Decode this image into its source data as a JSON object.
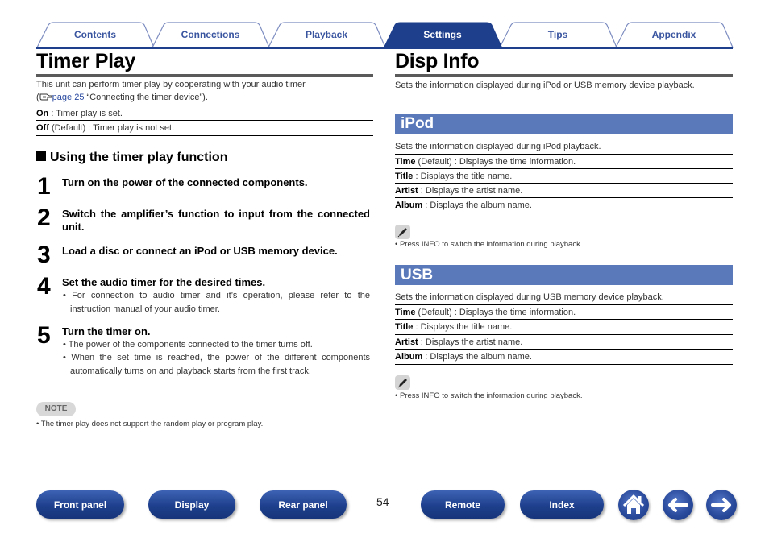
{
  "tabs": [
    {
      "label": "Contents",
      "active": false
    },
    {
      "label": "Connections",
      "active": false
    },
    {
      "label": "Playback",
      "active": false
    },
    {
      "label": "Settings",
      "active": true
    },
    {
      "label": "Tips",
      "active": false
    },
    {
      "label": "Appendix",
      "active": false
    }
  ],
  "colors": {
    "brand": "#1e3f8c",
    "band": "#5a79bb",
    "tab_text": "#3a55a0"
  },
  "left": {
    "title": "Timer Play",
    "intro_line1": "This unit can perform timer play by cooperating with your audio timer",
    "intro_open": "(",
    "intro_link": "page 25",
    "intro_rest": " “Connecting the timer device”).",
    "options": [
      {
        "key": "On",
        "desc": " : Timer play is set."
      },
      {
        "key": "Off",
        "desc": " (Default) : Timer play is not set."
      }
    ],
    "subheading": "Using the timer play function",
    "steps": [
      {
        "num": "1",
        "title": "Turn on the power of the connected components.",
        "bullets": []
      },
      {
        "num": "2",
        "title": "Switch the amplifier’s function to input from the connected unit.",
        "bullets": []
      },
      {
        "num": "3",
        "title": "Load a disc or connect an iPod or USB memory device.",
        "bullets": []
      },
      {
        "num": "4",
        "title": "Set the audio timer for the desired times.",
        "bullets": [
          "• For connection to audio timer and it’s operation, please refer to the instruction manual of your audio timer."
        ]
      },
      {
        "num": "5",
        "title": "Turn the timer on.",
        "bullets": [
          "• The power of the components connected to the timer turns off.",
          "• When the set time is reached, the power of the different components automatically turns on and playback starts from the first track."
        ]
      }
    ],
    "note_label": "NOTE",
    "note_text": "• The timer play does not support the random play or program play."
  },
  "right": {
    "title": "Disp Info",
    "intro": "Sets the information displayed during iPod or USB memory device playback.",
    "sections": [
      {
        "heading": "iPod",
        "desc": "Sets the information displayed during iPod playback.",
        "options": [
          {
            "key": "Time",
            "desc": " (Default) : Displays the time information."
          },
          {
            "key": "Title",
            "desc": " : Displays the title name."
          },
          {
            "key": "Artist",
            "desc": " : Displays the artist name."
          },
          {
            "key": "Album",
            "desc": " : Displays the album name."
          }
        ],
        "tip": "• Press INFO to switch the information during playback."
      },
      {
        "heading": "USB",
        "desc": "Sets the information displayed during USB memory device playback.",
        "options": [
          {
            "key": "Time",
            "desc": " (Default) : Displays the time information."
          },
          {
            "key": "Title",
            "desc": " : Displays the title name."
          },
          {
            "key": "Artist",
            "desc": " : Displays the artist name."
          },
          {
            "key": "Album",
            "desc": " : Displays the album name."
          }
        ],
        "tip": "• Press INFO to switch the information during playback."
      }
    ]
  },
  "footer": {
    "buttons": [
      "Front panel",
      "Display",
      "Rear panel",
      "Remote",
      "Index"
    ],
    "page_number": "54",
    "icons": [
      "home-icon",
      "back-arrow-icon",
      "forward-arrow-icon"
    ]
  }
}
